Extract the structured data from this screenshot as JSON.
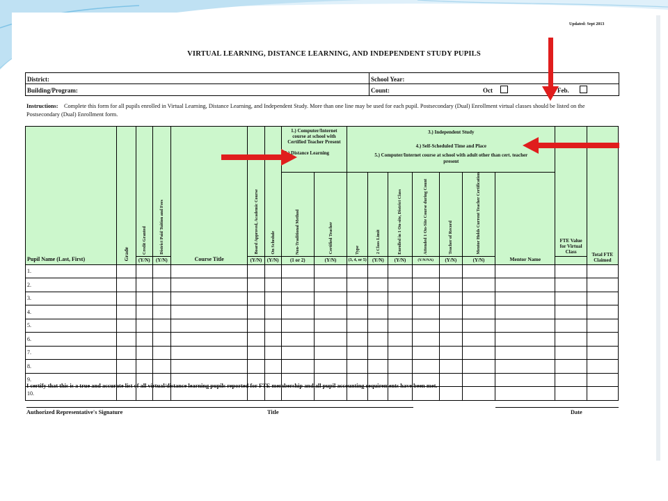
{
  "updated": "Updated:  Sept 2013",
  "title": "VIRTUAL LEARNING, DISTANCE LEARNING, AND INDEPENDENT STUDY PUPILS",
  "header": {
    "district": "District:",
    "school_year": "School Year:",
    "building": "Building/Program:",
    "count": "Count:",
    "oct": "Oct",
    "feb": "Feb."
  },
  "instructions": {
    "label": "Instructions:",
    "text": "Complete this form for all pupils enrolled in Virtual Learning, Distance Learning, and Independent Study.  More than one line may be used for each pupil.  Postsecondary (Dual) Enrollment virtual classes should be listed on the Postsecondary (Dual) Enrollment form."
  },
  "table": {
    "pupil_name": "Pupil Name (Last, First)",
    "grade": "Grade",
    "credit_granted": "Credit Granted",
    "district_paid": "District Paid Tuition and Fees",
    "course_title": "Course Title",
    "board_approved": "Board Approved, Academic Course",
    "on_schedule": "On Schedule",
    "opt1": "1.) Computer/Internet course at school with Certified Teacher Present",
    "opt2": "2.) Distance Learning",
    "non_traditional": "Non-Traditional Method",
    "certified_teacher": "Certified Teacher",
    "opt3": "3.)  Independent Study",
    "opt4": "4.)  Self-Scheduled Time and Place",
    "opt5": "5.)  Computer/Internet course at school with adult other than cert. teacher present",
    "type": "Type",
    "type_val": "(3, 4, or 5)",
    "class_limit": "2 Class Limit",
    "enrolled": "Enrolled in 1 On-site, District Class",
    "attended": "Attended 1 On-Site Course during Count",
    "teacher_record": "Teacher of Record",
    "mentor_holds": "Mentor Holds Current Teacher Certification",
    "mentor_name": "Mentor Name",
    "fte_value": "FTE Value for Virtual Class",
    "total_fte": "Total FTE Claimed",
    "yn": "(Y/N)",
    "ynna": "(Y/N/NA)",
    "one_or_two": "(1 or 2)",
    "rows": [
      "1.",
      "2.",
      "3.",
      "4.",
      "5.",
      "6.",
      "7.",
      "8.",
      "9.",
      "10."
    ]
  },
  "certify": "I certify that this is a true and accurate list of all virtual/distance learning pupils reported for FTE membership and all pupil accounting requirements have been met.",
  "signature": {
    "sig_label": "Authorized Representative's Signature",
    "title_label": "Title",
    "date_label": "Date"
  },
  "colors": {
    "header_fill": "#ccf7cc",
    "arrow": "#e01d1d",
    "swoosh": "#cfe8f5"
  }
}
